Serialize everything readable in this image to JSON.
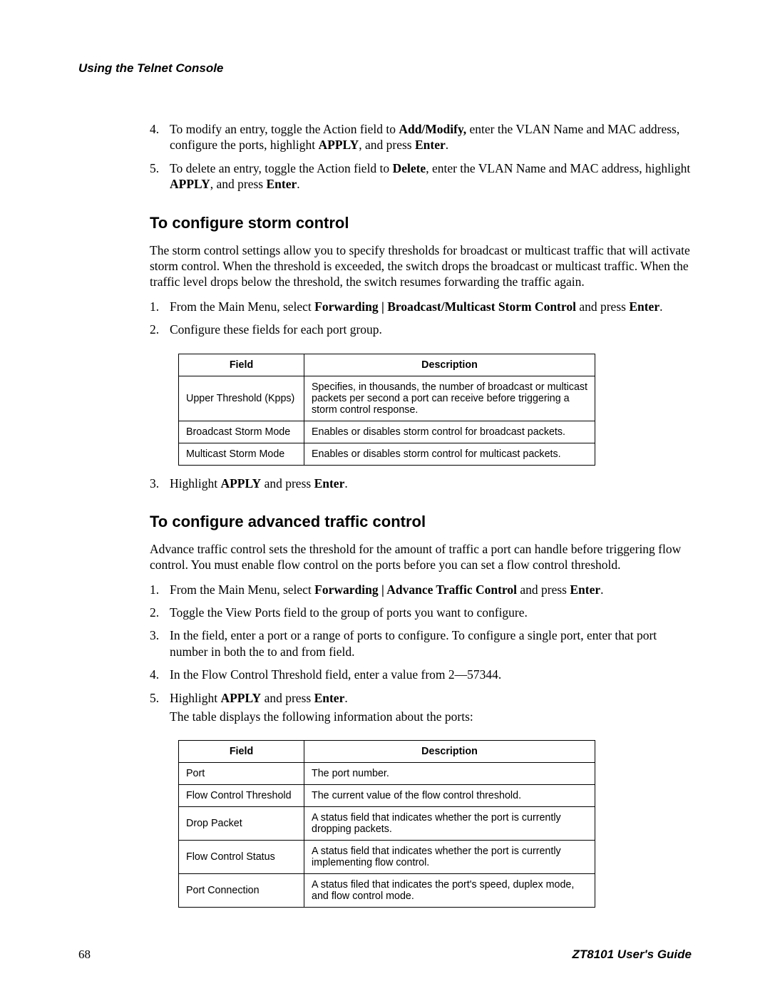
{
  "running_heading": "Using the Telnet Console",
  "intro_list": [
    {
      "num": "4.",
      "html": "To modify an entry, toggle the Action field to <b>Add/Modify,</b> enter the VLAN Name and MAC address, configure the ports, highlight <b>APPLY</b>, and press <b>Enter</b>."
    },
    {
      "num": "5.",
      "html": "To delete an entry, toggle the Action field to <b>Delete</b>, enter the VLAN Name and MAC address, highlight <b>APPLY</b>, and press <b>Enter</b>."
    }
  ],
  "section1": {
    "heading": "To configure storm control",
    "para": "The storm control settings allow you to specify thresholds for broadcast or multicast traffic that will activate storm control. When the threshold is exceeded, the switch drops the broadcast or multicast traffic. When the traffic level drops below the threshold, the switch resumes forwarding the traffic again.",
    "list": [
      {
        "num": "1.",
        "html": "From the Main Menu, select <b>Forwarding | Broadcast/Multicast Storm Control</b> and press <b>Enter</b>."
      },
      {
        "num": "2.",
        "html": "Configure these fields for each port group."
      }
    ],
    "table": {
      "head": [
        "Field",
        "Description"
      ],
      "rows": [
        [
          "Upper Threshold (Kpps)",
          "Specifies, in thousands, the number of broadcast or multicast packets per second a port can receive before triggering a storm control response."
        ],
        [
          "Broadcast Storm Mode",
          "Enables or disables storm control for broadcast packets."
        ],
        [
          "Multicast Storm Mode",
          "Enables or disables storm control for multicast packets."
        ]
      ]
    },
    "list_after": [
      {
        "num": "3.",
        "html": "Highlight <b>APPLY</b> and press <b>Enter</b>."
      }
    ]
  },
  "section2": {
    "heading": "To configure advanced traffic control",
    "para": "Advance traffic control sets the threshold for the amount of traffic a port can handle before triggering flow control. You must enable flow control on the ports before you can set a flow control threshold.",
    "list": [
      {
        "num": "1.",
        "html": "From the Main Menu, select <b>Forwarding | Advance Traffic Control</b> and press <b>Enter</b>."
      },
      {
        "num": "2.",
        "html": "Toggle the View Ports field to the group of ports you want to configure."
      },
      {
        "num": "3.",
        "html": "In the field, enter a port or a range of ports to configure. To configure a single port, enter that port number in both the to and from field."
      },
      {
        "num": "4.",
        "html": "In the Flow Control Threshold field, enter a value from 2—57344."
      },
      {
        "num": "5.",
        "html": "Highlight <b>APPLY</b> and press <b>Enter</b>."
      }
    ],
    "subtext": "The table displays the following information about the ports:",
    "table": {
      "head": [
        "Field",
        "Description"
      ],
      "rows": [
        [
          "Port",
          "The port number."
        ],
        [
          "Flow Control Threshold",
          "The current value of the flow control threshold."
        ],
        [
          "Drop Packet",
          "A status field that indicates whether the port is currently dropping packets."
        ],
        [
          "Flow Control Status",
          "A status field that indicates whether the port is currently implementing flow control."
        ],
        [
          "Port Connection",
          "A status filed that indicates the port's speed, duplex mode, and flow control mode."
        ]
      ]
    }
  },
  "footer": {
    "page": "68",
    "guide": "ZT8101 User's Guide"
  }
}
